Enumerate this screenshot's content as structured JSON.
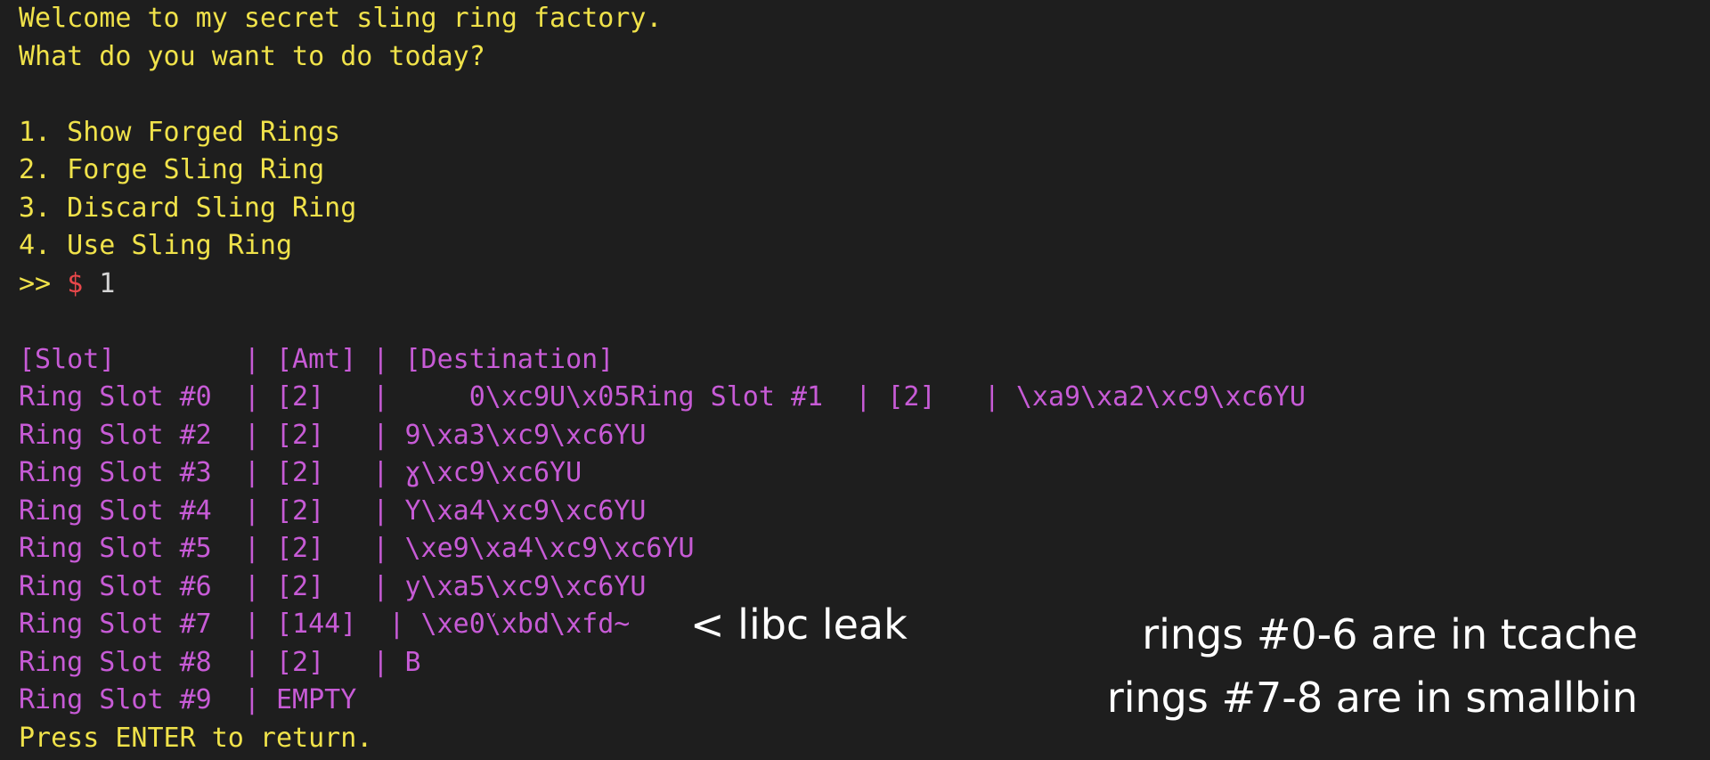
{
  "terminal": {
    "welcome": "Welcome to my secret sling ring factory.",
    "question": "What do you want to do today?",
    "menu": [
      "1. Show Forged Rings",
      "2. Forge Sling Ring",
      "3. Discard Sling Ring",
      "4. Use Sling Ring"
    ],
    "prompt_arrows": ">>",
    "prompt_dollar": "$",
    "prompt_input": " 1",
    "table_rows": [
      "[Slot]        | [Amt] | [Destination]",
      "Ring Slot #0  | [2]   |     0\\xc9U\\x05Ring Slot #1  | [2]   | \\xa9\\xa2\\xc9\\xc6YU",
      "Ring Slot #2  | [2]   | 9\\xa3\\xc9\\xc6YU",
      "Ring Slot #3  | [2]   | ɣ\\xc9\\xc6YU",
      "Ring Slot #4  | [2]   | Y\\xa4\\xc9\\xc6YU",
      "Ring Slot #5  | [2]   | \\xe9\\xa4\\xc9\\xc6YU",
      "Ring Slot #6  | [2]   | y\\xa5\\xc9\\xc6YU",
      "Ring Slot #7  | [144]  | \\xe0ܿ\\xbd\\xfd~",
      "Ring Slot #8  | [2]   | B",
      "Ring Slot #9  | EMPTY"
    ],
    "footer": "Press ENTER to return."
  },
  "annotations": {
    "libc_leak": "< libc leak",
    "tcache": "rings #0-6 are in tcache",
    "smallbin": "rings #7-8 are in smallbin"
  },
  "colors": {
    "background": "#1e1e1e",
    "menu_text": "#f0e24a",
    "table_text": "#c75bd6",
    "prompt_dollar": "#e8474a",
    "annotation_text": "#ffffff"
  }
}
